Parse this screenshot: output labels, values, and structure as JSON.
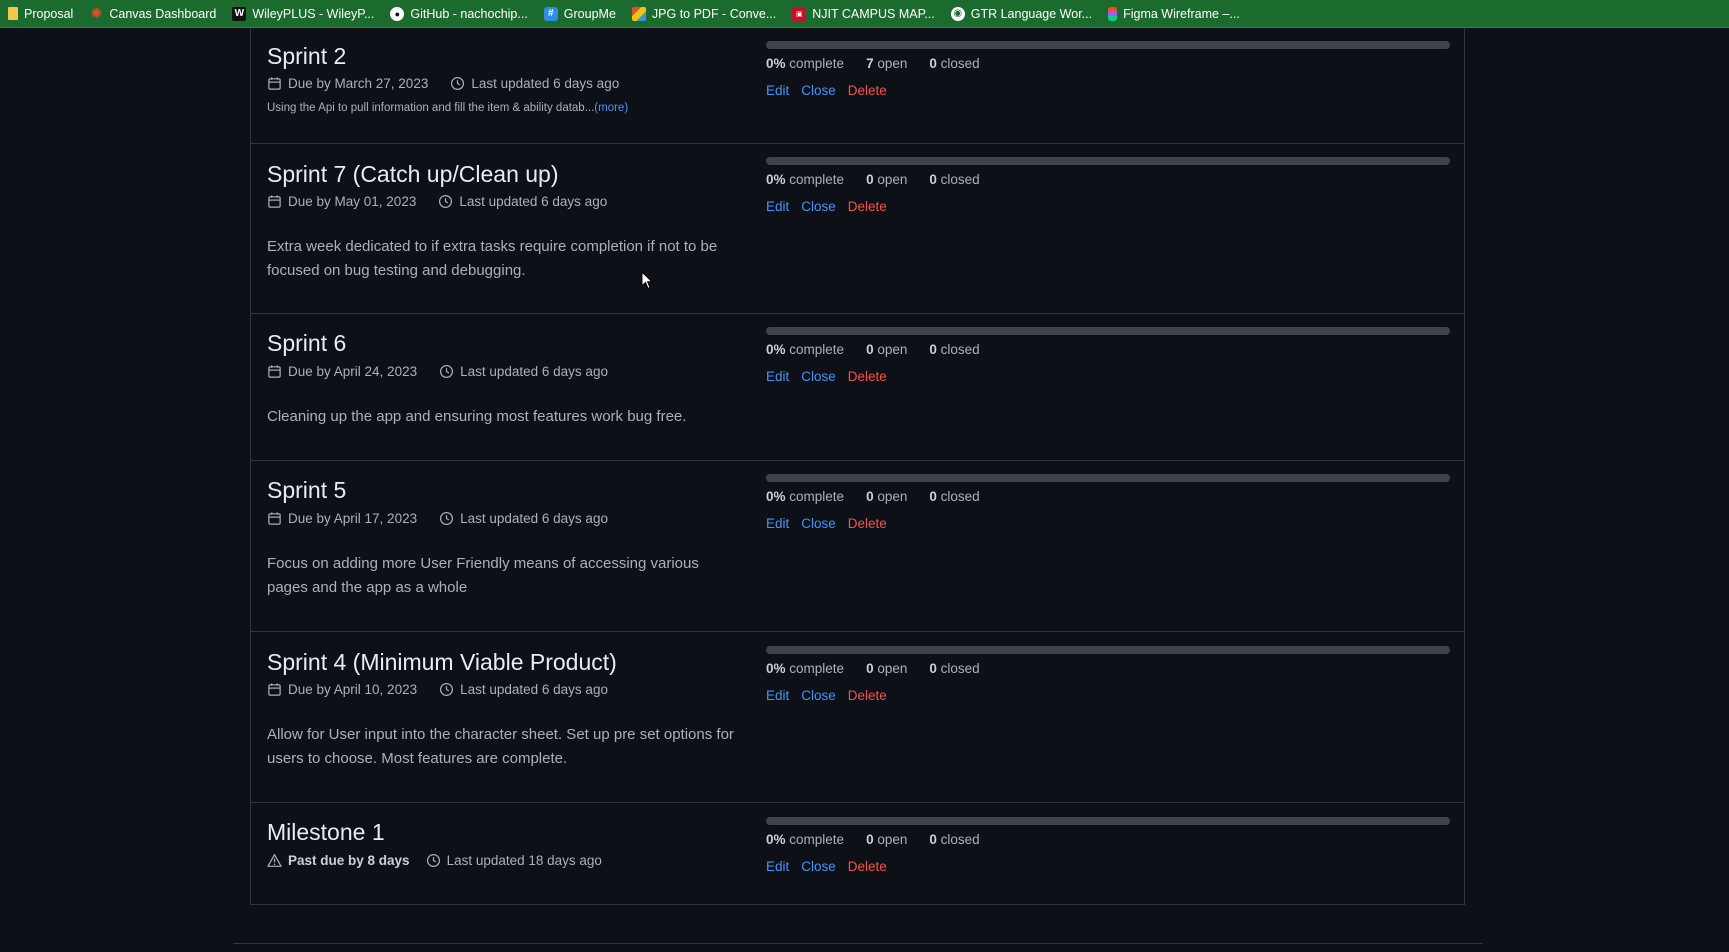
{
  "bookmarks": [
    {
      "label": "Proposal",
      "icon": "folder-icon"
    },
    {
      "label": "Canvas Dashboard",
      "icon": "canvas-icon"
    },
    {
      "label": "WileyPLUS - WileyP...",
      "icon": "wiley-icon"
    },
    {
      "label": "GitHub - nachochip...",
      "icon": "github-icon"
    },
    {
      "label": "GroupMe",
      "icon": "groupme-icon"
    },
    {
      "label": "JPG to PDF - Conve...",
      "icon": "jpg-to-pdf-icon"
    },
    {
      "label": "NJIT CAMPUS MAP...",
      "icon": "njit-icon"
    },
    {
      "label": "GTR Language Wor...",
      "icon": "globe-icon"
    },
    {
      "label": "Figma Wireframe –...",
      "icon": "figma-icon"
    }
  ],
  "milestones": [
    {
      "title": "Sprint 2",
      "due": "Due by March 27, 2023",
      "updated": "Last updated 6 days ago",
      "description": "Using the Api to pull information and fill the item & ability datab...",
      "more": "(more)",
      "progress": 0,
      "complete_pct": "0%",
      "complete_label": "complete",
      "open_count": "7",
      "open_label": "open",
      "closed_count": "0",
      "closed_label": "closed",
      "actions": {
        "edit": "Edit",
        "close": "Close",
        "delete": "Delete"
      }
    },
    {
      "title": "Sprint 7 (Catch up/Clean up)",
      "due": "Due by May 01, 2023",
      "updated": "Last updated 6 days ago",
      "description": "Extra week dedicated to if extra tasks require completion if not to be focused on bug testing and debugging.",
      "progress": 0,
      "complete_pct": "0%",
      "complete_label": "complete",
      "open_count": "0",
      "open_label": "open",
      "closed_count": "0",
      "closed_label": "closed",
      "actions": {
        "edit": "Edit",
        "close": "Close",
        "delete": "Delete"
      }
    },
    {
      "title": "Sprint 6",
      "due": "Due by April 24, 2023",
      "updated": "Last updated 6 days ago",
      "description": "Cleaning up the app and ensuring most features work bug free.",
      "progress": 0,
      "complete_pct": "0%",
      "complete_label": "complete",
      "open_count": "0",
      "open_label": "open",
      "closed_count": "0",
      "closed_label": "closed",
      "actions": {
        "edit": "Edit",
        "close": "Close",
        "delete": "Delete"
      }
    },
    {
      "title": "Sprint 5",
      "due": "Due by April 17, 2023",
      "updated": "Last updated 6 days ago",
      "description": "Focus on adding more User Friendly means of accessing various pages and the app as a whole",
      "progress": 0,
      "complete_pct": "0%",
      "complete_label": "complete",
      "open_count": "0",
      "open_label": "open",
      "closed_count": "0",
      "closed_label": "closed",
      "actions": {
        "edit": "Edit",
        "close": "Close",
        "delete": "Delete"
      }
    },
    {
      "title": "Sprint 4 (Minimum Viable Product)",
      "due": "Due by April 10, 2023",
      "updated": "Last updated 6 days ago",
      "description": "Allow for User input into the character sheet. Set up pre set options for users to choose. Most features are complete.",
      "progress": 0,
      "complete_pct": "0%",
      "complete_label": "complete",
      "open_count": "0",
      "open_label": "open",
      "closed_count": "0",
      "closed_label": "closed",
      "actions": {
        "edit": "Edit",
        "close": "Close",
        "delete": "Delete"
      }
    },
    {
      "title": "Milestone 1",
      "due": "Past due by 8 days",
      "updated": "Last updated 18 days ago",
      "description": "",
      "progress": 0,
      "complete_pct": "0%",
      "complete_label": "complete",
      "open_count": "0",
      "open_label": "open",
      "closed_count": "0",
      "closed_label": "closed",
      "actions": {
        "edit": "Edit",
        "close": "Close",
        "delete": "Delete"
      }
    }
  ],
  "colors": {
    "background": "#0d1117",
    "bookmarks_bar": "#1c6b2e",
    "link": "#4493f8",
    "danger": "#f85149",
    "progress_track": "#3d444d"
  }
}
